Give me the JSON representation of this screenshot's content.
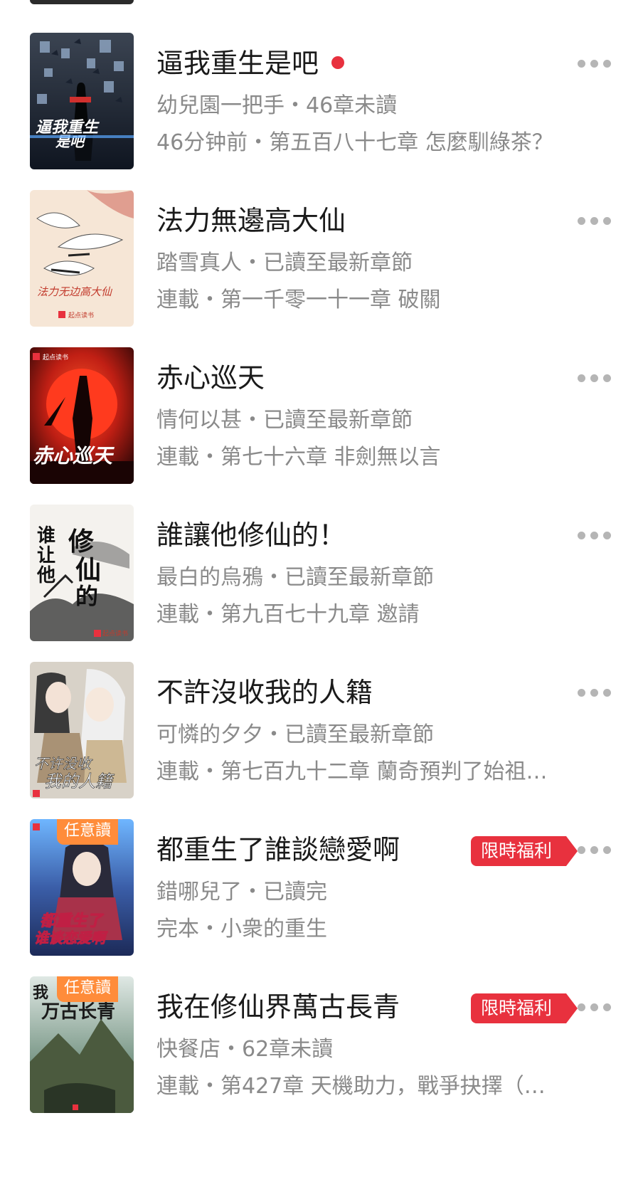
{
  "books": [
    {
      "title": "逼我重生是吧",
      "unread_dot": true,
      "line2": "幼兒園一把手・46章未讀",
      "line3": "46分钟前・第五百八十七章 怎麼馴綠茶？",
      "cover": {
        "theme": "dark-butterflies",
        "text": "逼我重生是吧"
      }
    },
    {
      "title": "法力無邊高大仙",
      "line2": "踏雪真人・已讀至最新章節",
      "line3": "連載・第一千零一十一章 破關",
      "cover": {
        "theme": "cream-cranes",
        "text": "法力无边高大仙"
      }
    },
    {
      "title": "赤心巡天",
      "line2": "情何以甚・已讀至最新章節",
      "line3": "連載・第七十六章 非劍無以言",
      "cover": {
        "theme": "red-sun",
        "text": "赤心巡天"
      }
    },
    {
      "title": "誰讓他修仙的！",
      "line2": "最白的烏鴉・已讀至最新章節",
      "line3": "連載・第九百七十九章 邀請",
      "cover": {
        "theme": "ink-mountain",
        "text": "谁让他修仙的"
      }
    },
    {
      "title": "不許沒收我的人籍",
      "line2": "可憐的夕夕・已讀至最新章節",
      "line3": "連載・第七百九十二章 蘭奇預判了始祖…",
      "cover": {
        "theme": "anime-pair",
        "text": "不许没收我的人籍"
      }
    },
    {
      "title": "都重生了誰談戀愛啊",
      "promo": "限時福利",
      "badge": "任意讀",
      "line2": "錯哪兒了・已讀完",
      "line3": "完本・小衆的重生",
      "cover": {
        "theme": "blue-anime",
        "text": "都重生了谁谈恋爱啊"
      }
    },
    {
      "title": "我在修仙界萬古長青",
      "promo": "限時福利",
      "badge": "任意讀",
      "line2": "快餐店・62章未讀",
      "line3": "連載・第427章 天機助力，戰爭抉擇（…",
      "cover": {
        "theme": "mountain-gold",
        "text": "万古长青"
      }
    }
  ],
  "colors": {
    "accent": "#e8313e",
    "badge": "#ff8c3a",
    "muted": "#8a8a8a"
  },
  "icons": {
    "more": "more-dots-icon"
  }
}
